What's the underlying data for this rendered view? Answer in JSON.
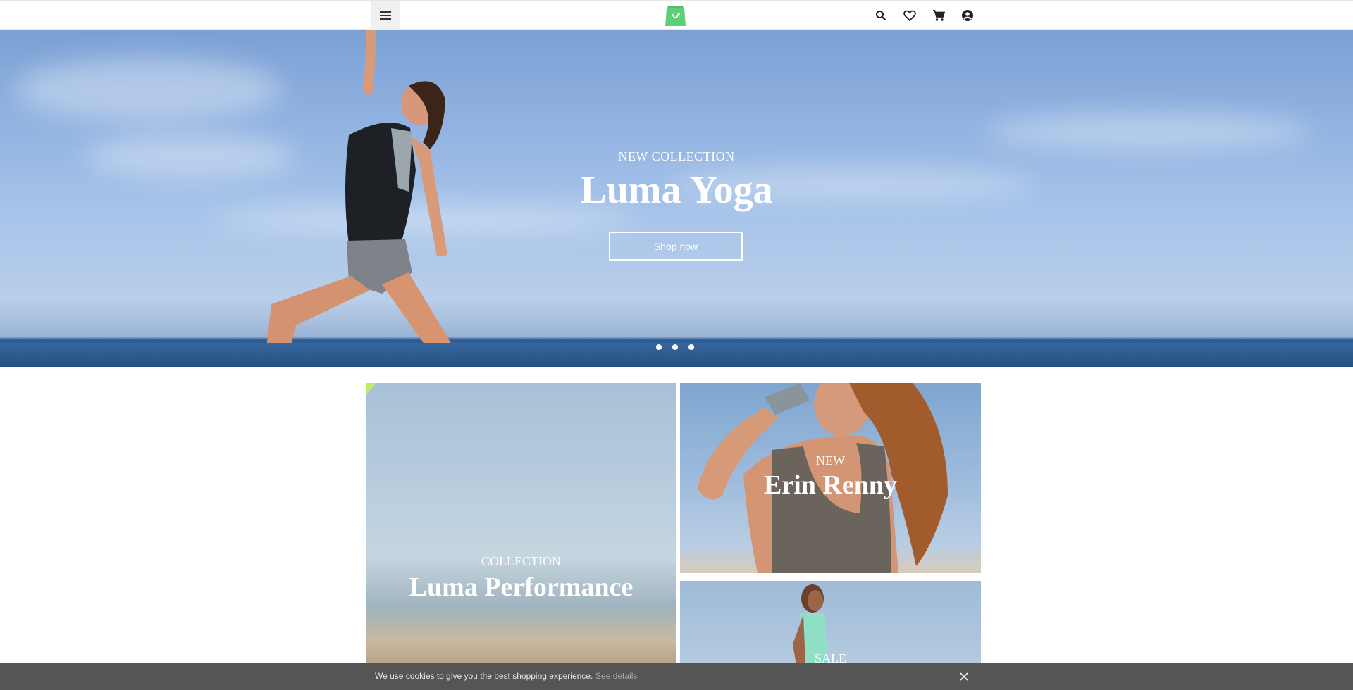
{
  "header": {
    "menu_icon": "hamburger-icon",
    "logo_icon": "shopping-bag-logo",
    "icons": [
      "search-icon",
      "heart-icon",
      "cart-icon",
      "account-icon"
    ],
    "logo_color": "#5ece7b"
  },
  "hero": {
    "subtitle": "NEW COLLECTION",
    "title": "Luma Yoga",
    "button_label": "Shop now",
    "slides_count": 3
  },
  "tiles": {
    "performance": {
      "subtitle": "COLLECTION",
      "title": "Luma Performance"
    },
    "erin": {
      "subtitle": "NEW",
      "title": "Erin Renny"
    },
    "sale": {
      "subtitle": "SALE"
    }
  },
  "cookie": {
    "message": "We use cookies to give you the best shopping experience.",
    "link_label": "See details",
    "close_icon": "close-icon"
  }
}
